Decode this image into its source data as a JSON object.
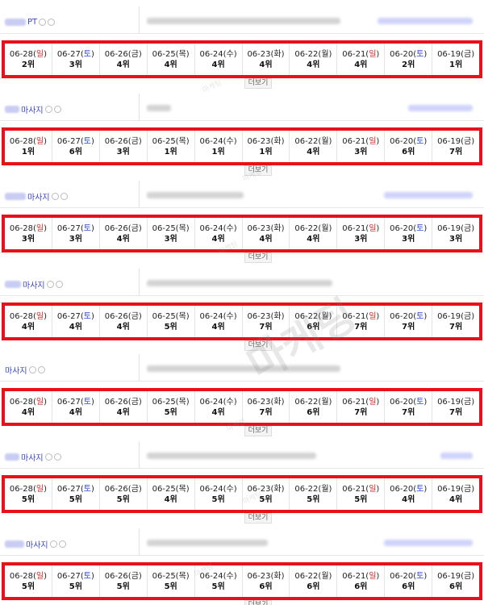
{
  "more_label": "더보기",
  "rank_suffix": "위",
  "watermark": "마케팅",
  "dates": [
    {
      "md": "06-28",
      "dow": "일",
      "kind": "sun"
    },
    {
      "md": "06-27",
      "dow": "토",
      "kind": "sat"
    },
    {
      "md": "06-26",
      "dow": "금",
      "kind": ""
    },
    {
      "md": "06-25",
      "dow": "목",
      "kind": ""
    },
    {
      "md": "06-24",
      "dow": "수",
      "kind": ""
    },
    {
      "md": "06-23",
      "dow": "화",
      "kind": ""
    },
    {
      "md": "06-22",
      "dow": "월",
      "kind": ""
    },
    {
      "md": "06-21",
      "dow": "일",
      "kind": "sun"
    },
    {
      "md": "06-20",
      "dow": "토",
      "kind": "sat"
    },
    {
      "md": "06-19",
      "dow": "금",
      "kind": ""
    }
  ],
  "keywords": [
    {
      "label": "PT",
      "ranks": [
        2,
        3,
        4,
        4,
        4,
        4,
        4,
        4,
        2,
        1
      ]
    },
    {
      "label": "마사지",
      "ranks": [
        1,
        6,
        3,
        1,
        1,
        1,
        4,
        3,
        6,
        7
      ]
    },
    {
      "label": "마사지",
      "ranks": [
        3,
        3,
        4,
        3,
        4,
        4,
        4,
        3,
        3,
        3
      ]
    },
    {
      "label": "마사지",
      "ranks": [
        4,
        4,
        4,
        5,
        4,
        7,
        6,
        7,
        7,
        7
      ]
    },
    {
      "label": "마사지",
      "ranks": [
        4,
        4,
        4,
        5,
        4,
        7,
        6,
        7,
        7,
        7
      ]
    },
    {
      "label": "마사지",
      "ranks": [
        5,
        5,
        5,
        4,
        5,
        5,
        5,
        5,
        4,
        4
      ]
    },
    {
      "label": "마사지",
      "ranks": [
        5,
        5,
        5,
        5,
        5,
        6,
        6,
        6,
        6,
        6
      ]
    }
  ]
}
